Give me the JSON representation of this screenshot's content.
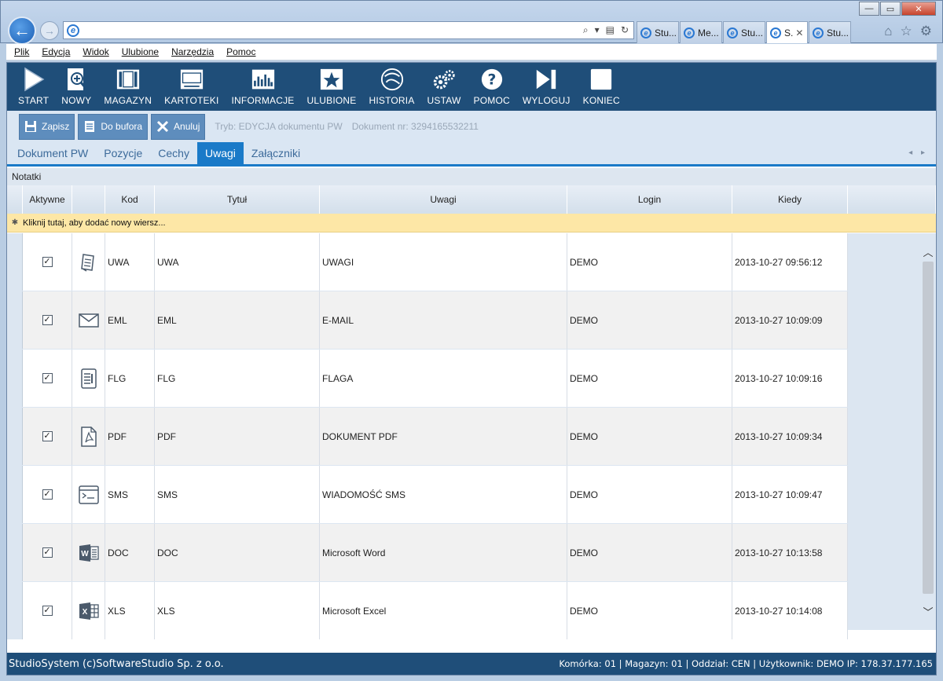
{
  "browser": {
    "window_buttons": [
      "—",
      "▭",
      "✕"
    ],
    "address_value": "",
    "tabs": [
      {
        "label": "Stu..."
      },
      {
        "label": "Me..."
      },
      {
        "label": "Stu..."
      },
      {
        "label": "S."
      },
      {
        "label": "Stu..."
      }
    ],
    "active_tab_index": 3
  },
  "menu": [
    "Plik",
    "Edycja",
    "Widok",
    "Ulubione",
    "Narzędzia",
    "Pomoc"
  ],
  "toolbar": [
    {
      "label": "START",
      "icon": "play-icon"
    },
    {
      "label": "NOWY",
      "icon": "new-document-icon"
    },
    {
      "label": "MAGAZYN",
      "icon": "warehouse-icon"
    },
    {
      "label": "KARTOTEKI",
      "icon": "records-icon"
    },
    {
      "label": "INFORMACJE",
      "icon": "chart-icon"
    },
    {
      "label": "ULUBIONE",
      "icon": "star-icon"
    },
    {
      "label": "HISTORIA",
      "icon": "history-icon"
    },
    {
      "label": "USTAW",
      "icon": "gears-icon"
    },
    {
      "label": "POMOC",
      "icon": "help-icon"
    },
    {
      "label": "WYLOGUJ",
      "icon": "logout-icon"
    },
    {
      "label": "KONIEC",
      "icon": "stop-icon"
    }
  ],
  "commands": {
    "save_label": "Zapisz",
    "buffer_label": "Do bufora",
    "cancel_label": "Anuluj",
    "mode_text": "Tryb: EDYCJA dokumentu PW",
    "doc_text": "Dokument nr: 3294165532211"
  },
  "tabs": [
    {
      "label": "Dokument PW"
    },
    {
      "label": "Pozycje"
    },
    {
      "label": "Cechy"
    },
    {
      "label": "Uwagi"
    },
    {
      "label": "Załączniki"
    }
  ],
  "active_tab": "Uwagi",
  "section_label": "Notatki",
  "grid": {
    "columns": [
      "Aktywne",
      "",
      "Kod",
      "Tytuł",
      "Uwagi",
      "Login",
      "Kiedy"
    ],
    "new_row_text": "Kliknij tutaj, aby dodać nowy wiersz...",
    "rows": [
      {
        "active": true,
        "icon": "note-icon",
        "kod": "UWA",
        "tytul": "UWA",
        "uwagi": "UWAGI",
        "login": "DEMO",
        "kiedy": "2013-10-27 09:56:12"
      },
      {
        "active": true,
        "icon": "envelope-icon",
        "kod": "EML",
        "tytul": "EML",
        "uwagi": "E-MAIL",
        "login": "DEMO",
        "kiedy": "2013-10-27 10:09:09"
      },
      {
        "active": true,
        "icon": "flag-document-icon",
        "kod": "FLG",
        "tytul": "FLG",
        "uwagi": "FLAGA",
        "login": "DEMO",
        "kiedy": "2013-10-27 10:09:16"
      },
      {
        "active": true,
        "icon": "pdf-icon",
        "kod": "PDF",
        "tytul": "PDF",
        "uwagi": "DOKUMENT PDF",
        "login": "DEMO",
        "kiedy": "2013-10-27 10:09:34"
      },
      {
        "active": true,
        "icon": "sms-icon",
        "kod": "SMS",
        "tytul": "SMS",
        "uwagi": "WIADOMOŚĆ SMS",
        "login": "DEMO",
        "kiedy": "2013-10-27 10:09:47"
      },
      {
        "active": true,
        "icon": "word-icon",
        "kod": "DOC",
        "tytul": "DOC",
        "uwagi": "Microsoft Word",
        "login": "DEMO",
        "kiedy": "2013-10-27 10:13:58"
      },
      {
        "active": true,
        "icon": "excel-icon",
        "kod": "XLS",
        "tytul": "XLS",
        "uwagi": "Microsoft Excel",
        "login": "DEMO",
        "kiedy": "2013-10-27 10:14:08"
      }
    ]
  },
  "status": {
    "left": "StudioSystem (c)SoftwareStudio Sp. z o.o.",
    "right": "Komórka: 01 | Magazyn: 01 | Oddział: CEN | Użytkownik: DEMO IP: 178.37.177.165"
  }
}
